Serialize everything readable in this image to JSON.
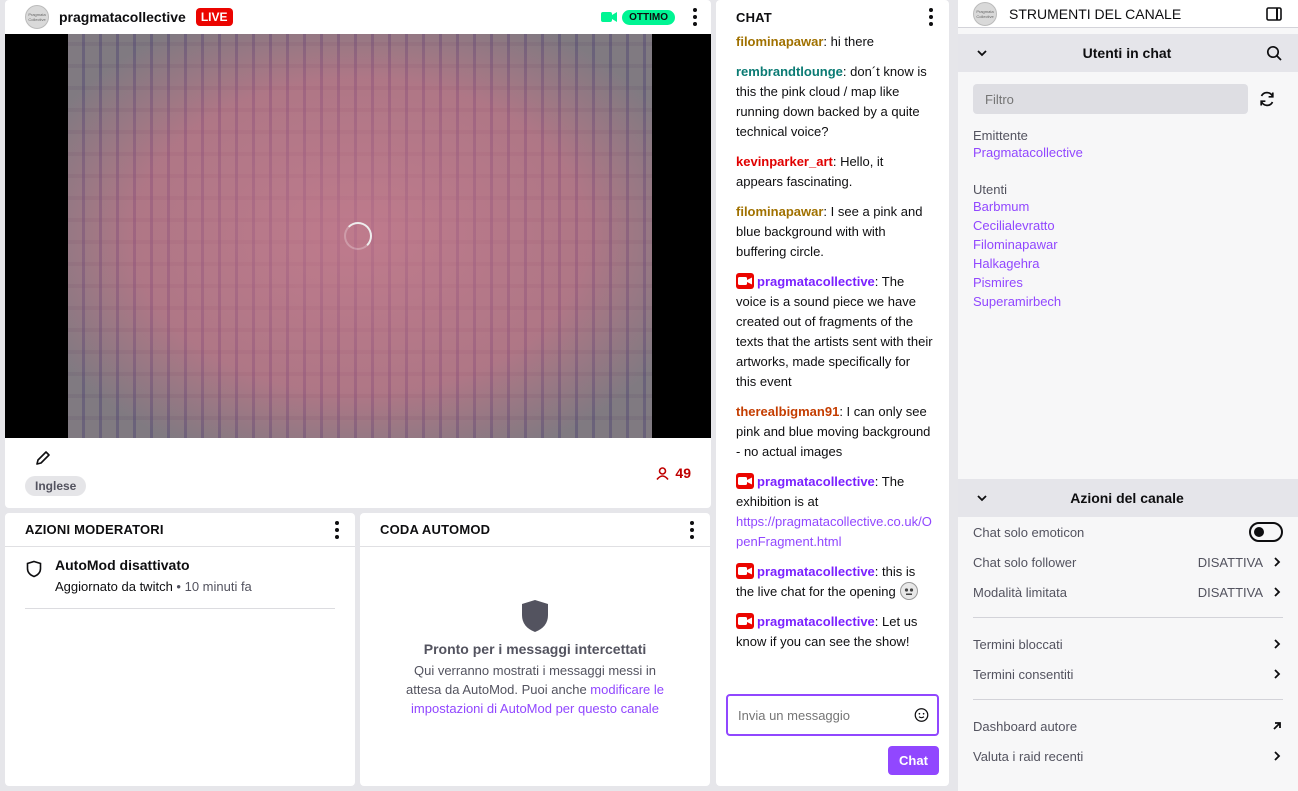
{
  "stream": {
    "channel": "pragmatacollective",
    "avatar_text": "Pragmata Collective",
    "live_label": "LIVE",
    "quality": "OTTIMO",
    "language": "Inglese",
    "viewers": "49"
  },
  "moderator": {
    "title": "AZIONI MODERATORI",
    "item_title": "AutoMod disattivato",
    "item_sub": "Aggiornato da twitch",
    "item_time": "• 10 minuti fa"
  },
  "automod": {
    "title": "CODA AUTOMOD",
    "heading": "Pronto per i messaggi intercettati",
    "text": "Qui verranno mostrati i messaggi messi in attesa da AutoMod. Puoi anche",
    "link": "modificare le impostazioni di AutoMod per questo canale"
  },
  "chat": {
    "title": "CHAT",
    "messages": [
      {
        "user": "filominapawar",
        "color": "#a07100",
        "text": ": hi there",
        "badge": false
      },
      {
        "user": "rembrandtlounge",
        "color": "#0a7a73",
        "text": ": don´t know is this the pink cloud / map like running down backed by a quite technical voice?",
        "badge": false
      },
      {
        "user": "kevinparker_art",
        "color": "#e00000",
        "text": ": Hello, it appears fascinating.",
        "badge": false
      },
      {
        "user": "filominapawar",
        "color": "#a07100",
        "text": ": I see a pink and blue background with with buffering circle.",
        "badge": false
      },
      {
        "user": "pragmatacollective",
        "color": "#7b22ff",
        "text": ": The voice is a sound piece we have created out of fragments of the texts that the artists sent with their artworks, made specifically for this event",
        "badge": true
      },
      {
        "user": "therealbigman91",
        "color": "#c43d00",
        "text": ": I can only see pink and blue moving background - no actual images",
        "badge": false
      },
      {
        "user": "pragmatacollective",
        "color": "#7b22ff",
        "text": ": The exhibition is at ",
        "link": "https://pragmatacollective.co.uk/OpenFragment.html",
        "badge": true
      },
      {
        "user": "pragmatacollective",
        "color": "#7b22ff",
        "text": ": this is the live chat for the opening",
        "badge": true,
        "emoji": true
      },
      {
        "user": "pragmatacollective",
        "color": "#7b22ff",
        "text": ": Let us know if you can see the show!",
        "badge": true
      }
    ],
    "input_placeholder": "Invia un messaggio",
    "send_label": "Chat"
  },
  "tools": {
    "title": "STRUMENTI DEL CANALE",
    "users_section": "Utenti in chat",
    "filter_placeholder": "Filtro",
    "broadcaster_label": "Emittente",
    "broadcaster": "Pragmatacollective",
    "users_label": "Utenti",
    "users": [
      "Barbmum",
      "Cecilialevratto",
      "Filominapawar",
      "Halkagehra",
      "Pismires",
      "Superamirbech"
    ],
    "actions_section": "Azioni del canale",
    "emote_only": "Chat solo emoticon",
    "follower_only": "Chat solo follower",
    "follower_value": "DISATTIVA",
    "slow_mode": "Modalità limitata",
    "slow_value": "DISATTIVA",
    "blocked_terms": "Termini bloccati",
    "allowed_terms": "Termini consentiti",
    "creator_dashboard": "Dashboard autore",
    "rate_raids": "Valuta i raid recenti"
  },
  "colors": {
    "accent": "#9147ff",
    "live": "#eb0400",
    "quality": "#00f593",
    "viewers": "#bf0000"
  }
}
